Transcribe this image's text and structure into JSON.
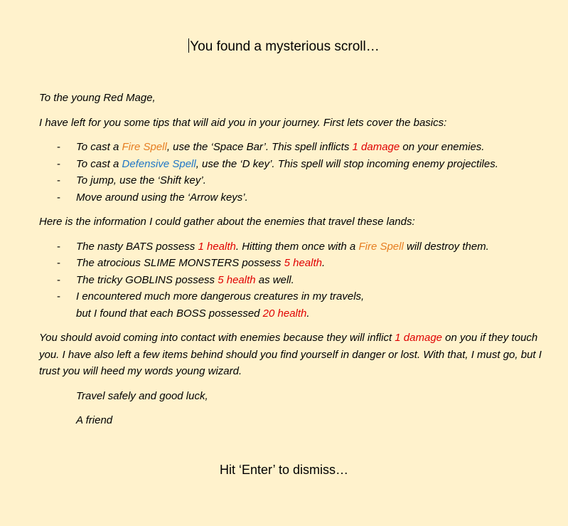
{
  "title": "You found a mysterious scroll…",
  "greeting": "To the young Red Mage,",
  "intro": "I have left for you some tips that will aid you in your journey. First lets cover the basics:",
  "controls": [
    {
      "pre": "To cast a ",
      "spell": "Fire Spell",
      "mid": ", use the ‘Space Bar’. This spell inflicts ",
      "dmg": "1 damage",
      "post": " on your enemies."
    },
    {
      "pre": "To cast a ",
      "spell": "Defensive Spell",
      "post": ", use the ‘D key’. This spell will stop incoming enemy projectiles."
    },
    {
      "text": "To jump, use the ‘Shift key’."
    },
    {
      "text": "Move around using the ‘Arrow keys’."
    }
  ],
  "enemies_intro": "Here is the information I could gather about the enemies that travel these lands:",
  "enemies": [
    {
      "pre": "The nasty BATS possess ",
      "health": "1 health",
      "mid": ". Hitting them once with a ",
      "spell": "Fire Spell",
      "post": " will destroy them."
    },
    {
      "pre": "The atrocious SLIME MONSTERS possess ",
      "health": "5 health",
      "post": "."
    },
    {
      "pre": "The tricky GOBLINS possess ",
      "health": "5 health",
      "post": " as well."
    },
    {
      "line1": "I encountered much more dangerous creatures in my travels,",
      "pre": "but I found that each BOSS possessed ",
      "health": "20 health",
      "post": "."
    }
  ],
  "warning": {
    "pre": "You should avoid coming into contact with enemies because they will inflict ",
    "dmg": "1 damage",
    "post": " on you if they touch you. I have also left a few items behind should you find yourself in danger or lost. With that, I must go, but I trust you will heed my words young wizard."
  },
  "farewell": "Travel safely and good luck,",
  "signature": "A friend",
  "footer": "Hit ‘Enter’ to dismiss…",
  "colors": {
    "background": "#fff2cc",
    "fire_spell": "#e67e22",
    "defensive_spell": "#1f77c6",
    "damage": "#e00000"
  }
}
